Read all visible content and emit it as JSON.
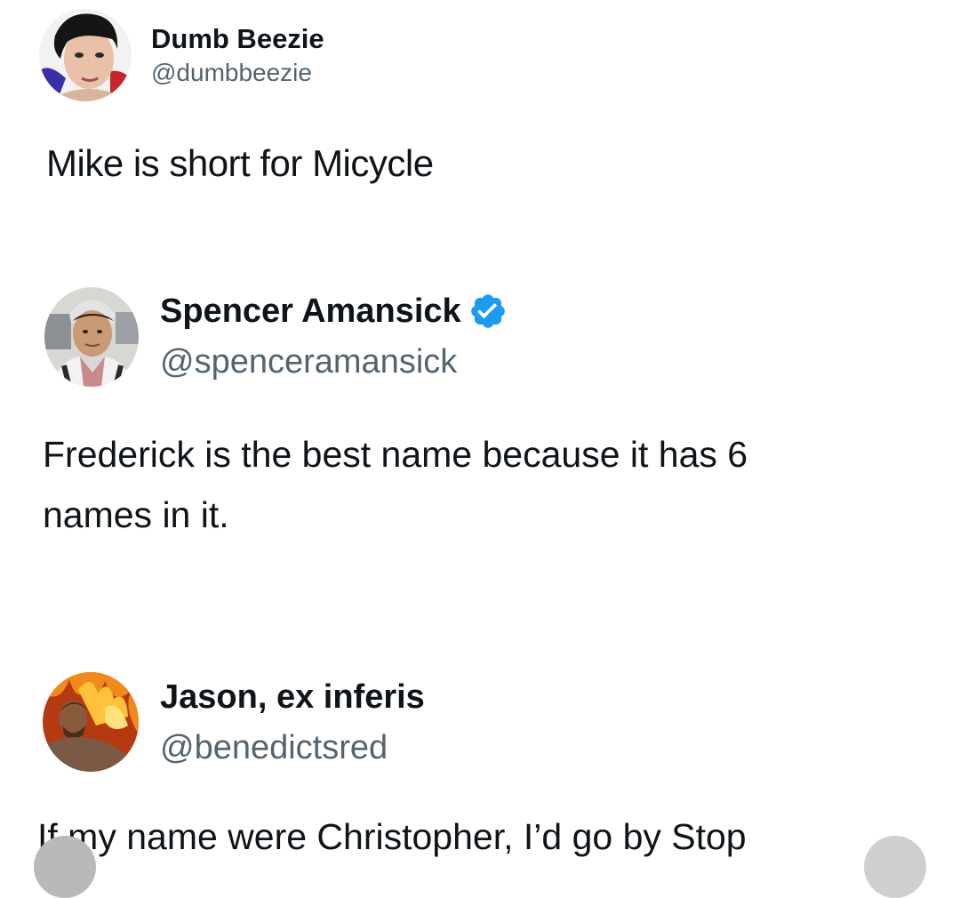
{
  "tweets": [
    {
      "display_name": "Dumb Beezie",
      "handle": "@dumbbeezie",
      "verified": false,
      "text": [
        "Mike is short for Micycle"
      ],
      "avatar_icon": "portrait-woman-avatar"
    },
    {
      "display_name": "Spencer Amansick",
      "handle": "@spenceramansick",
      "verified": true,
      "text": [
        "Frederick is the best name because it has 6",
        "names in it."
      ],
      "avatar_icon": "portrait-man-avatar"
    },
    {
      "display_name": "Jason, ex inferis",
      "handle": "@benedictsred",
      "verified": false,
      "text": [
        "If my name were Christopher, I’d go by Stop"
      ],
      "avatar_icon": "portrait-fire-avatar"
    }
  ],
  "colors": {
    "verified_badge": "#1d9bf0",
    "handle_text": "#536471",
    "body_text": "#0f1419"
  }
}
